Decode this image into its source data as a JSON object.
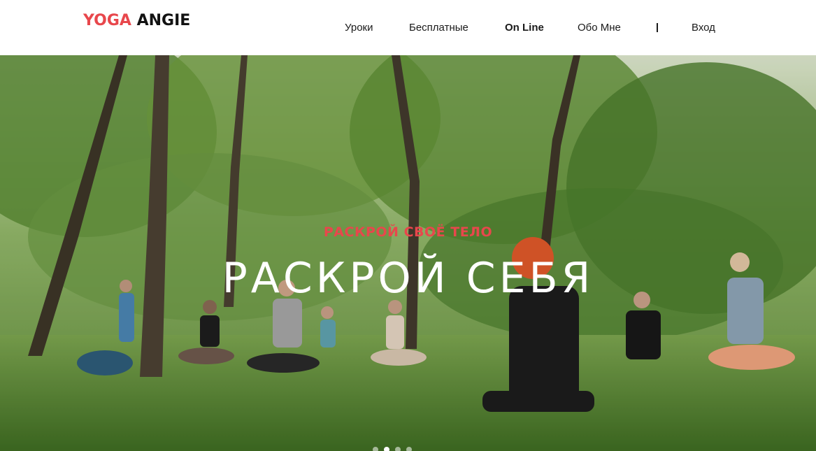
{
  "header": {
    "logo_part1": "YOGA",
    "logo_part2": "ANGIE",
    "nav": [
      {
        "label": "Уроки"
      },
      {
        "label": "Бесплатные"
      },
      {
        "label": "On Line"
      },
      {
        "label": "Обо Мне"
      },
      {
        "label": "Вход"
      }
    ],
    "active_nav": "On Line"
  },
  "hero": {
    "kicker": "РАСКРОЙ СВОЁ ТЕЛО",
    "title": "РАСКРОЙ СЕБЯ",
    "slides": 4,
    "active_slide": 1
  },
  "colors": {
    "accent": "#e8474c",
    "text_dark": "#121212",
    "hero_title": "#ffffff"
  }
}
